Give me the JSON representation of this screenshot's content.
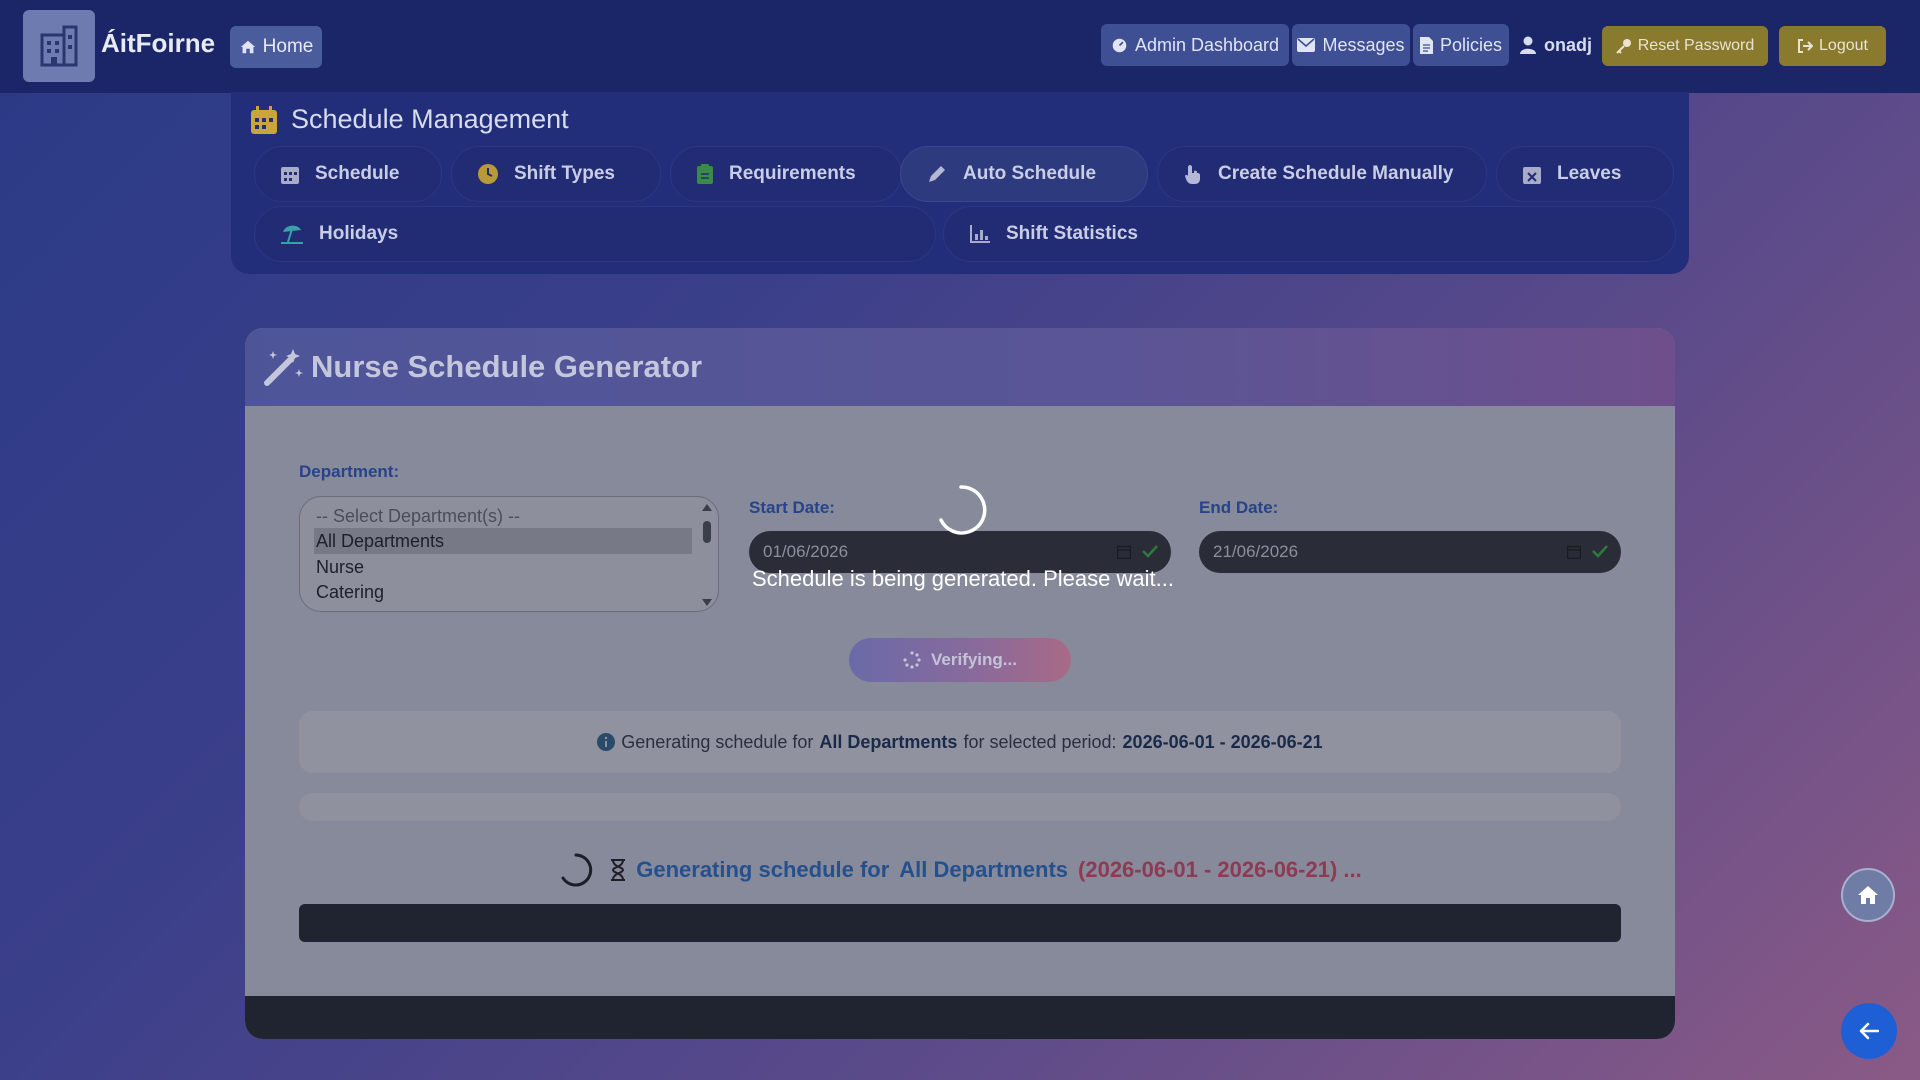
{
  "navbar": {
    "brand": "ÁitFoirne",
    "home_label": "Home",
    "admin_dashboard_label": "Admin Dashboard",
    "messages_label": "Messages",
    "policies_label": "Policies",
    "username": "onadj",
    "reset_password_label": "Reset Password",
    "logout_label": "Logout"
  },
  "management": {
    "title": "Schedule Management",
    "tabs": [
      {
        "label": "Schedule",
        "icon": "calendar-grid-icon"
      },
      {
        "label": "Shift Types",
        "icon": "clock-icon"
      },
      {
        "label": "Requirements",
        "icon": "clipboard-icon"
      },
      {
        "label": "Auto Schedule",
        "icon": "pencil-icon",
        "active": true
      },
      {
        "label": "Create Schedule Manually",
        "icon": "hand-pointer-icon"
      },
      {
        "label": "Leaves",
        "icon": "calendar-x-icon"
      },
      {
        "label": "Holidays",
        "icon": "umbrella-beach-icon"
      },
      {
        "label": "Shift Statistics",
        "icon": "bar-chart-icon"
      }
    ]
  },
  "generator": {
    "title": "Nurse Schedule Generator",
    "department_label": "Department:",
    "department_options": [
      "-- Select Department(s) --",
      "All Departments",
      "Nurse",
      "Catering"
    ],
    "department_selected": "All Departments",
    "start_date_label": "Start Date:",
    "start_date_value": "01/06/2026",
    "end_date_label": "End Date:",
    "end_date_value": "21/06/2026",
    "verify_button_label": "Verifying...",
    "info": {
      "prefix": "Generating schedule for",
      "department": "All Departments",
      "middle": "for selected period:",
      "period": "2026-06-01 - 2026-06-21"
    },
    "status": {
      "prefix": "Generating schedule for",
      "department": "All Departments",
      "period": "(2026-06-01 - 2026-06-21) ..."
    }
  },
  "overlay": {
    "message": "Schedule is being generated. Please wait..."
  },
  "colors": {
    "navbar_bg": "#1a2668",
    "accent_gold": "#8a7a2e",
    "label_blue": "#27438a",
    "back_button": "#1f5fd6"
  }
}
